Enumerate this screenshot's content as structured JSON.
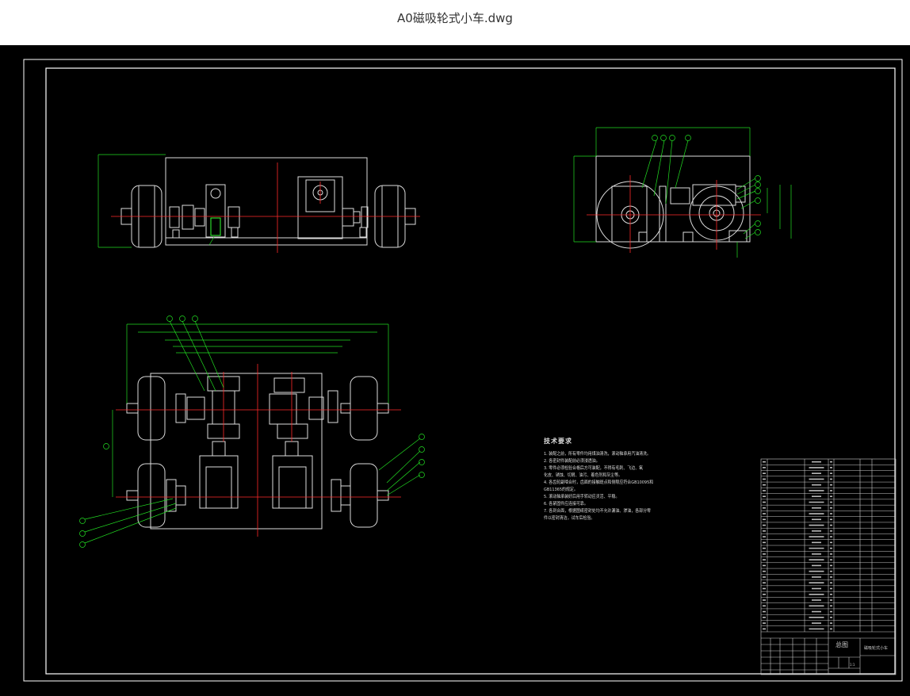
{
  "window": {
    "title": "A0磁吸轮式小车.dwg"
  },
  "drawing": {
    "colors": {
      "background": "#000000",
      "frame": "#ffffff",
      "outline": "#dddddd",
      "centerline": "#ff2a2a",
      "dimension": "#22dd22",
      "accent": "#33ff33"
    },
    "tech_requirements": {
      "heading": "技术要求",
      "items": [
        "1. 装配之前，所有零件均用煤油清洗，滚动轴承用汽油清洗。",
        "2. 各密封件装配前必须浸透油。",
        "3. 零件必须检验合格后方可装配，不得有毛刺、飞边、氧",
        "   化皮、锈蚀、切屑、油污、着色剂和灰尘等。",
        "4. 各齿轮副啮合时，齿面的接触斑点和侧隙应符合GB10095和",
        "   GB11365的规定。",
        "5. 滚动轴承装好后用手转动应灵活、平稳。",
        "6. 各紧固件应连接可靠。",
        "7. 各到合面，根据图纸密封处均不允许漏油、渗油，各部分零",
        "   件以密封清洁，试车后检验。"
      ]
    },
    "title_block": {
      "name": "总图",
      "part": "磁吸轮式小车",
      "labels": [
        "标记",
        "处数",
        "分区",
        "更改文件号",
        "签名",
        "年月日",
        "设计",
        "标准化",
        "阶段标记",
        "重量",
        "比例",
        "审核",
        "工艺",
        "批准",
        "共",
        "张",
        "第",
        "张",
        "序号",
        "代号",
        "名称",
        "数量",
        "材料",
        "备注"
      ],
      "scale": "1:1"
    },
    "bom_rows": 30
  }
}
